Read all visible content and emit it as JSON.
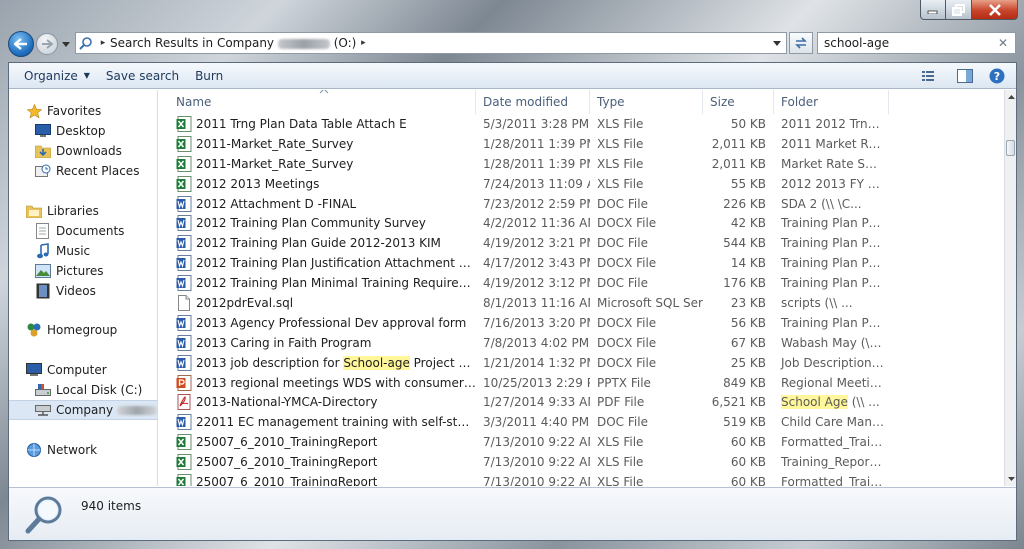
{
  "window": {
    "minimize_label": "",
    "maximize_label": "",
    "close_label": ""
  },
  "address": {
    "path_prefix": "Search Results in Company",
    "path_suffix": "(O:)"
  },
  "search": {
    "value": "school-age",
    "clear_glyph": "✕"
  },
  "toolbar": {
    "organize": "Organize",
    "save_search": "Save search",
    "burn": "Burn"
  },
  "nav": {
    "favorites": "Favorites",
    "desktop": "Desktop",
    "downloads": "Downloads",
    "recent_places": "Recent Places",
    "libraries": "Libraries",
    "documents": "Documents",
    "music": "Music",
    "pictures": "Pictures",
    "videos": "Videos",
    "homegroup": "Homegroup",
    "computer": "Computer",
    "local_disk": "Local Disk (C:)",
    "company": "Company",
    "network": "Network"
  },
  "columns": {
    "name": "Name",
    "date_modified": "Date modified",
    "type": "Type",
    "size": "Size",
    "folder": "Folder"
  },
  "files": [
    {
      "name": "2011 Trng Plan Data Table Attach E",
      "date": "5/3/2011 3:28 PM",
      "type": "XLS File",
      "size": "50 KB",
      "folder": "2011 2012 Trng Pl...",
      "icon": "excel-icon"
    },
    {
      "name": "2011-Market_Rate_Survey",
      "date": "1/28/2011 1:39 PM",
      "type": "XLS File",
      "size": "2,011 KB",
      "folder": "2011 Market Rate ...",
      "icon": "excel-icon"
    },
    {
      "name": "2011-Market_Rate_Survey",
      "date": "1/28/2011 1:39 PM",
      "type": "XLS File",
      "size": "2,011 KB",
      "folder": "Market Rate Surve...",
      "icon": "excel-icon"
    },
    {
      "name": "2012 2013 Meetings",
      "date": "7/24/2013 11:09 AM",
      "type": "XLS File",
      "size": "55 KB",
      "folder": "2012 2013 FY Meet...",
      "icon": "excel-icon"
    },
    {
      "name": "2012 Attachment D -FINAL",
      "date": "7/23/2012 2:59 PM",
      "type": "DOC File",
      "size": "226 KB",
      "folder": "SDA 2 (\\\\          \\C...",
      "icon": "word-icon"
    },
    {
      "name": "2012 Training Plan Community Survey",
      "date": "4/2/2012 11:36 AM",
      "type": "DOCX File",
      "size": "42 KB",
      "folder": "Training Plan Proc...",
      "icon": "word-icon"
    },
    {
      "name": "2012 Training Plan Guide 2012-2013  KIM",
      "date": "4/19/2012 3:21 PM",
      "type": "DOC File",
      "size": "544 KB",
      "folder": "Training Plan Proc...",
      "icon": "word-icon"
    },
    {
      "name": "2012 Training Plan Justification Attachment A  KIM",
      "date": "4/17/2012 3:43 PM",
      "type": "DOCX File",
      "size": "14 KB",
      "folder": "Training Plan Proc...",
      "icon": "word-icon"
    },
    {
      "name": "2012 Training Plan Minimal Training Requirements A...",
      "date": "4/19/2012 3:12 PM",
      "type": "DOC File",
      "size": "176 KB",
      "folder": "Training Plan Proc...",
      "icon": "word-icon"
    },
    {
      "name": "2012pdrEval.sql",
      "date": "8/1/2013 11:16 AM",
      "type": "Microsoft SQL Ser...",
      "size": "23 KB",
      "folder": "scripts (\\\\            ...",
      "icon": "blank-file-icon"
    },
    {
      "name": "2013 Agency Professional Dev approval form",
      "date": "7/16/2013 3:20 PM",
      "type": "DOCX File",
      "size": "56 KB",
      "folder": "Training Plan Proc...",
      "icon": "word-icon"
    },
    {
      "name": "2013 Caring in Faith Program",
      "date": "7/8/2013 4:02 PM",
      "type": "DOCX File",
      "size": "67 KB",
      "folder": "Wabash  May (\\\\         ...",
      "icon": "word-icon"
    },
    {
      "name_before": "2013 job description for ",
      "name_hl": "School-age",
      "name_after": " Project Coordin...",
      "date": "1/21/2014 1:32 PM",
      "type": "DOCX File",
      "size": "25 KB",
      "folder": "Job Descriptions (...",
      "icon": "word-icon"
    },
    {
      "name": "2013 regional meetings WDS with consumer ed",
      "date": "10/25/2013 2:29 PM",
      "type": "PPTX File",
      "size": "849 KB",
      "folder": "Regional Meeting...",
      "icon": "powerpoint-icon"
    },
    {
      "name": "2013-National-YMCA-Directory",
      "date": "1/27/2014 9:33 AM",
      "type": "PDF File",
      "size": "6,521 KB",
      "folder_hl": "School Age",
      "folder_after": " (\\\\          ...",
      "icon": "pdf-icon"
    },
    {
      "name": "22011 EC management training with self-study porti...",
      "date": "3/3/2011 4:40 PM",
      "type": "DOC File",
      "size": "519 KB",
      "folder": "Child Care Manag...",
      "icon": "word-icon"
    },
    {
      "name": "25007_6_2010_TrainingReport",
      "date": "7/13/2010 9:22 AM",
      "type": "XLS File",
      "size": "60 KB",
      "folder": "Formatted_Trainin...",
      "icon": "excel-icon"
    },
    {
      "name": "25007_6_2010_TrainingReport",
      "date": "7/13/2010 9:22 AM",
      "type": "XLS File",
      "size": "60 KB",
      "folder": "Training_Reports (...",
      "icon": "excel-icon"
    },
    {
      "name": "25007_6_2010_TrainingReport",
      "date": "7/13/2010 9:22 AM",
      "type": "XLS File",
      "size": "60 KB",
      "folder": "Formatted_Trainin...",
      "icon": "excel-icon"
    }
  ],
  "status": {
    "item_count": "940 items"
  },
  "colors": {
    "accent": "#1f6fc0",
    "highlight": "#fff79a",
    "excel": "#1f7a3a",
    "word": "#2b5aa8"
  }
}
